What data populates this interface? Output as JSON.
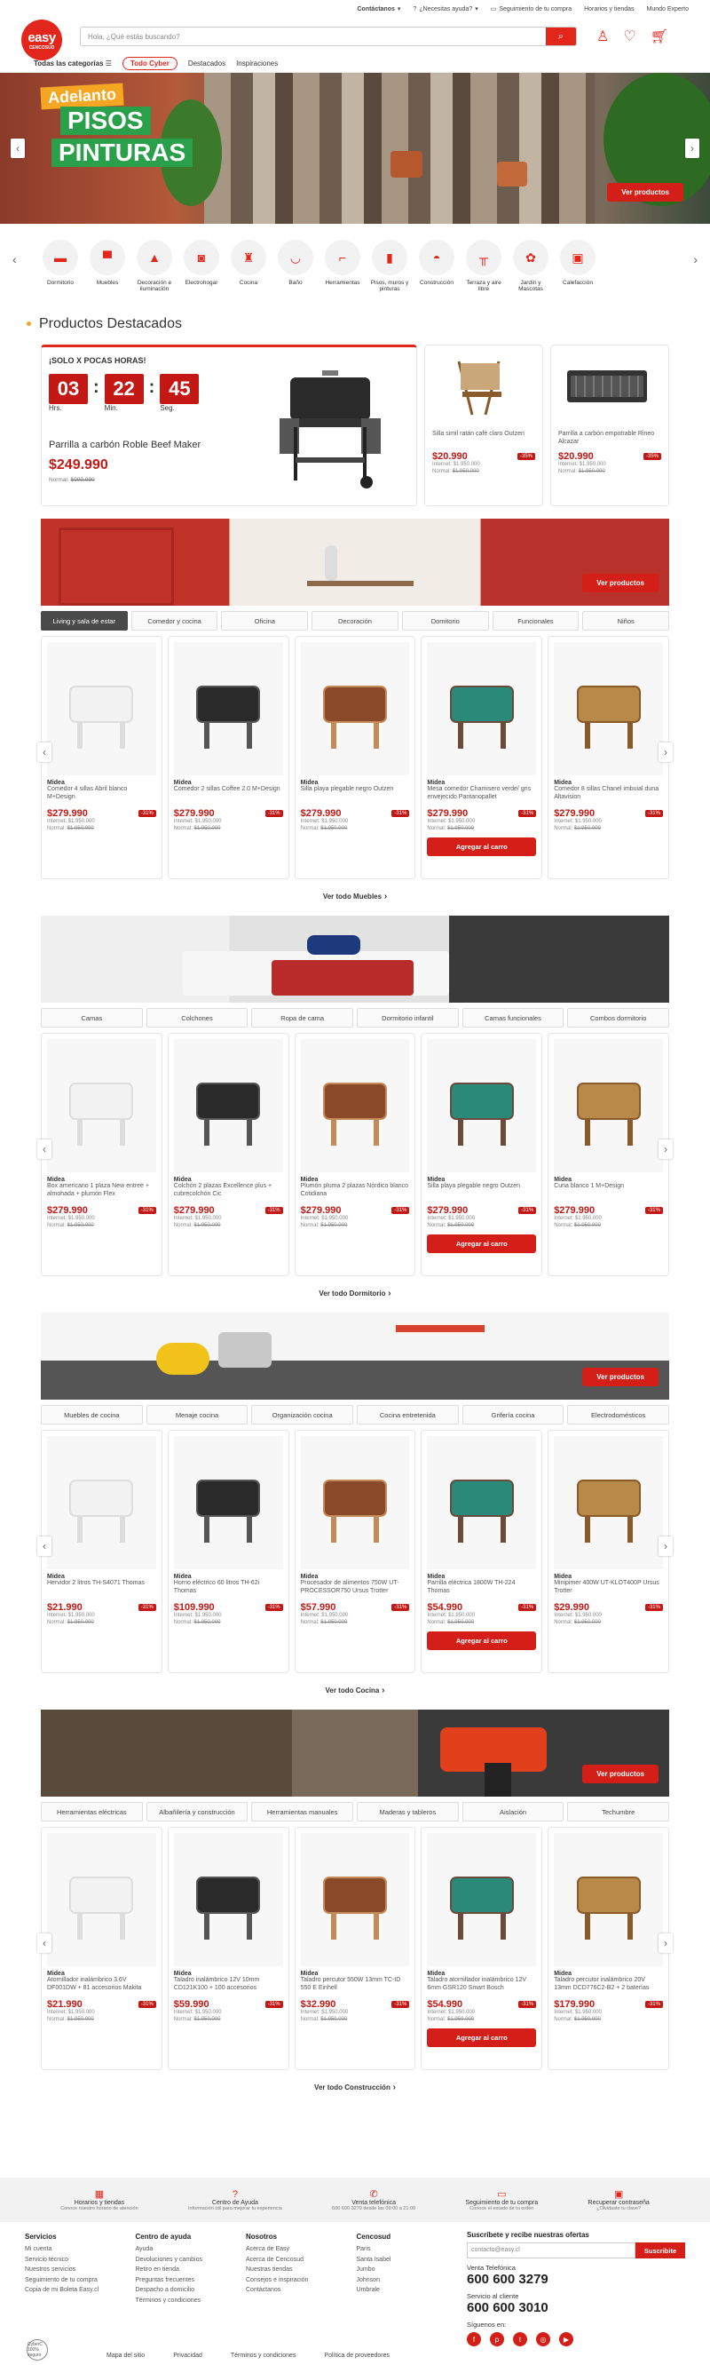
{
  "topbar": {
    "contact": "Contáctanos",
    "help": "¿Necesitas ayuda?",
    "track": "Seguimiento de tu compra",
    "hours": "Horarios y tiendas",
    "expert": "Mundo Experto"
  },
  "logo": {
    "name": "easy",
    "sub": "CENCOSUD"
  },
  "search": {
    "placeholder": "Hola, ¿Qué estás buscando?"
  },
  "nav": {
    "all": "Todas las categorías",
    "cyber": "Todo Cyber",
    "featured": "Destacados",
    "inspiration": "Inspiraciones"
  },
  "hero": {
    "tag1": "Adelanto",
    "tag2": "PISOS",
    "tag3": "PINTURAS",
    "cta": "Ver productos"
  },
  "categories": [
    "Dormitorio",
    "Muebles",
    "Decoración e iluminación",
    "Electrohogar",
    "Cocina",
    "Baño",
    "Herramientas",
    "Pisos, muros y pinturas",
    "Construcción",
    "Terraza y aire libre",
    "Jardín y Mascotas",
    "Calefacción"
  ],
  "featured": {
    "title": "Productos Destacados",
    "timer": {
      "label": "¡SOLO X POCAS HORAS!",
      "h": "03",
      "m": "22",
      "s": "45",
      "hl": "Hrs.",
      "ml": "Min.",
      "sl": "Seg."
    },
    "main": {
      "name": "Parrilla a carbón Roble Beef Maker",
      "price": "$249.990",
      "normal": "Normal:",
      "normal_price": "$999.990"
    },
    "cards": [
      {
        "name": "Silla simil ratán café claro Outzen",
        "price": "$20.990",
        "disc": "-35%",
        "internet": "Internet: $1.950.000",
        "normal": "Normal:",
        "normal_price": "$1.950.000"
      },
      {
        "name": "Parrilla a carbón empotrable Rineo Alcazar",
        "price": "$20.990",
        "disc": "-35%",
        "internet": "Internet: $1.950.000",
        "normal": "Normal:",
        "normal_price": "$1.950.000"
      }
    ]
  },
  "sections": [
    {
      "cta": "Ver productos",
      "tabs": [
        "Living y sala de estar",
        "Comedor y cocina",
        "Oficina",
        "Decoración",
        "Domitorio",
        "Funcionales",
        "Niños"
      ],
      "seeall": "Ver todo Muebles",
      "products": [
        {
          "brand": "Midea",
          "name": "Comedor 4 sillas Abril blanco M+Design",
          "price": "$279.990",
          "disc": "-31%",
          "internet": "Internet: $1.950.000",
          "normal": "Normal:",
          "normal_price": "$1.950.000",
          "cart": ""
        },
        {
          "brand": "Midea",
          "name": "Comedor 2 sillas Coffee 2.0 M+Design",
          "price": "$279.990",
          "disc": "-31%",
          "internet": "Internet: $1.950.000",
          "normal": "Normal:",
          "normal_price": "$1.950.000",
          "cart": ""
        },
        {
          "brand": "Midea",
          "name": "Silla playa plegable negro Outzen",
          "price": "$279.990",
          "disc": "-31%",
          "internet": "Internet: $1.950.000",
          "normal": "Normal:",
          "normal_price": "$1.950.000",
          "cart": ""
        },
        {
          "brand": "Midea",
          "name": "Mesa comedor Chamisero verde/ gris envejecido Pantanopallet",
          "price": "$279.990",
          "disc": "-31%",
          "internet": "Internet: $1.950.000",
          "normal": "Normal:",
          "normal_price": "$1.950.000",
          "cart": "Agregar al carro"
        },
        {
          "brand": "Midea",
          "name": "Comedor 8 sillas Chanel imbuial duna Altavision",
          "price": "$279.990",
          "disc": "-31%",
          "internet": "Internet: $1.950.000",
          "normal": "Normal:",
          "normal_price": "$1.950.000",
          "cart": ""
        }
      ]
    },
    {
      "cta": "",
      "tabs": [
        "Camas",
        "Colchones",
        "Ropa de cama",
        "Dormitorio infantil",
        "Camas funcionales",
        "Combos dormitorio"
      ],
      "seeall": "Ver todo Dormitorio",
      "products": [
        {
          "brand": "Midea",
          "name": "Box americano 1 plaza New entree + almohada + plumón Flex",
          "price": "$279.990",
          "disc": "-31%",
          "internet": "Internet: $1.950.000",
          "normal": "Normal:",
          "normal_price": "$1.950.000",
          "cart": ""
        },
        {
          "brand": "Midea",
          "name": "Colchón 2 plazas Excellence plus + cubrecolchón Cic",
          "price": "$279.990",
          "disc": "-31%",
          "internet": "Internet: $1.950.000",
          "normal": "Normal:",
          "normal_price": "$1.950.000",
          "cart": ""
        },
        {
          "brand": "Midea",
          "name": "Plumón pluma 2 plazas Nórdico blanco Cotidiana",
          "price": "$279.990",
          "disc": "-31%",
          "internet": "Internet: $1.950.000",
          "normal": "Normal:",
          "normal_price": "$1.950.000",
          "cart": ""
        },
        {
          "brand": "Midea",
          "name": "Silla playa plegable negro Outzen",
          "price": "$279.990",
          "disc": "-31%",
          "internet": "Internet: $1.950.000",
          "normal": "Normal:",
          "normal_price": "$1.950.000",
          "cart": "Agregar al carro"
        },
        {
          "brand": "Midea",
          "name": "Cuna blanco 1 M+Design",
          "price": "$279.990",
          "disc": "-31%",
          "internet": "Internet: $1.950.000",
          "normal": "Normal:",
          "normal_price": "$1.950.000",
          "cart": ""
        }
      ]
    },
    {
      "cta": "Ver productos",
      "tabs": [
        "Muebles de cocina",
        "Menaje cocina",
        "Organización cocina",
        "Cocina entretenida",
        "Grifería cocina",
        "Electrodomésticos"
      ],
      "seeall": "Ver todo Cocina",
      "products": [
        {
          "brand": "Midea",
          "name": "Hervidor 2 litros TH-S4071 Thomas",
          "price": "$21.990",
          "disc": "-31%",
          "internet": "Internet: $1.950.000",
          "normal": "Normal:",
          "normal_price": "$1.950.000",
          "cart": ""
        },
        {
          "brand": "Midea",
          "name": "Horno eléctrico 60 litros TH-62i Thomas",
          "price": "$109.990",
          "disc": "-31%",
          "internet": "Internet: $1.950.000",
          "normal": "Normal:",
          "normal_price": "$1.950.000",
          "cart": ""
        },
        {
          "brand": "Midea",
          "name": "Procesador de alimentos 750W UT-PROCESSOR750 Ursus Trotter",
          "price": "$57.990",
          "disc": "-31%",
          "internet": "Internet: $1.950.000",
          "normal": "Normal:",
          "normal_price": "$1.950.000",
          "cart": ""
        },
        {
          "brand": "Midea",
          "name": "Parrilla eléctrica 1800W TH-224 Thomas",
          "price": "$54.990",
          "disc": "-31%",
          "internet": "Internet: $1.950.000",
          "normal": "Normal:",
          "normal_price": "$1.950.000",
          "cart": "Agregar al carro"
        },
        {
          "brand": "Midea",
          "name": "Minipimer 400W UT-KLOT400P Ursus Trotter",
          "price": "$29.990",
          "disc": "-31%",
          "internet": "Internet: $1.950.000",
          "normal": "Normal:",
          "normal_price": "$1.950.000",
          "cart": ""
        }
      ]
    },
    {
      "cta": "Ver productos",
      "tabs": [
        "Herramientas eléctricas",
        "Albañilería y construcción",
        "Herramientas manuales",
        "Maderas y tableros",
        "Aislación",
        "Techumbre"
      ],
      "seeall": "Ver todo Construcción",
      "products": [
        {
          "brand": "Midea",
          "name": "Atornillador inalámbrico 3.6V DF001DW + 81 accesorios Makita",
          "price": "$21.990",
          "disc": "-31%",
          "internet": "Internet: $1.950.000",
          "normal": "Normal:",
          "normal_price": "$1.950.000",
          "cart": ""
        },
        {
          "brand": "Midea",
          "name": "Taladro inalámbrico 12V 10mm CD121K100 + 100 accesorios",
          "price": "$59.990",
          "disc": "-31%",
          "internet": "Internet: $1.950.000",
          "normal": "Normal:",
          "normal_price": "$1.950.000",
          "cart": ""
        },
        {
          "brand": "Midea",
          "name": "Taladro percutor 550W 13mm TC-ID 550 E Einhell",
          "price": "$32.990",
          "disc": "-31%",
          "internet": "Internet: $1.950.000",
          "normal": "Normal:",
          "normal_price": "$1.950.000",
          "cart": ""
        },
        {
          "brand": "Midea",
          "name": "Taladro atornillador inalámbrico 12V 6mm GSR120 Smart Bosch",
          "price": "$54.990",
          "disc": "-31%",
          "internet": "Internet: $1.950.000",
          "normal": "Normal:",
          "normal_price": "$1.950.000",
          "cart": "Agregar al carro"
        },
        {
          "brand": "Midea",
          "name": "Taladro percutor inalámbrico 20V 13mm DCD776C2-B2 + 2 baterías",
          "price": "$179.990",
          "disc": "-31%",
          "internet": "Internet: $1.950.000",
          "normal": "Normal:",
          "normal_price": "$1.950.000",
          "cart": ""
        }
      ]
    }
  ],
  "footerbar": [
    {
      "title": "Horarios y tiendas",
      "sub": "Conoce nuestro horario de atención"
    },
    {
      "title": "Centro de Ayuda",
      "sub": "Información útil para mejorar tu experiencia"
    },
    {
      "title": "Venta telefónica",
      "sub": "600 600 3279 desde las 09:00 a 21:00"
    },
    {
      "title": "Seguimiento de tu compra",
      "sub": "Conoce el estado de tu orden"
    },
    {
      "title": "Recuperar contraseña",
      "sub": "¿Olvidaste tu clave?"
    }
  ],
  "footer": {
    "cols": [
      {
        "title": "Servicios",
        "items": [
          "Mi cuenta",
          "Servicio técnico",
          "Nuestros servicios",
          "Seguimiento de tu compra",
          "Copia de mi Boleta Easy.cl"
        ]
      },
      {
        "title": "Centro de ayuda",
        "items": [
          "Ayuda",
          "Devoluciones y cambios",
          "Retiro en tienda",
          "Preguntas frecuentes",
          "Despacho a domicilio",
          "Términos y condiciones"
        ]
      },
      {
        "title": "Nosotros",
        "items": [
          "Acerca de Easy",
          "Acerca de Cencosud",
          "Nuestras tiendas",
          "Consejos e inspiración",
          "Contáctanos"
        ]
      },
      {
        "title": "Cencosud",
        "items": [
          "Paris",
          "Santa Isabel",
          "Jumbo",
          "Johnson",
          "Umbrale"
        ]
      }
    ],
    "subscribe_title": "Suscríbete y recibe nuestras ofertas",
    "subscribe_placeholder": "contacto@easy.cl",
    "subscribe_btn": "Suscribite",
    "phone_label": "Venta Telefónica",
    "phone": "600 600 3279",
    "service_label": "Servicio al cliente",
    "service_phone": "600 600 3010",
    "follow": "Síguenos en:",
    "bottom": [
      "Mapa del sitio",
      "Privacidad",
      "Términos y condiciones",
      "Política de proveedores"
    ],
    "cc_logo": "CyberC 100% seguro"
  }
}
